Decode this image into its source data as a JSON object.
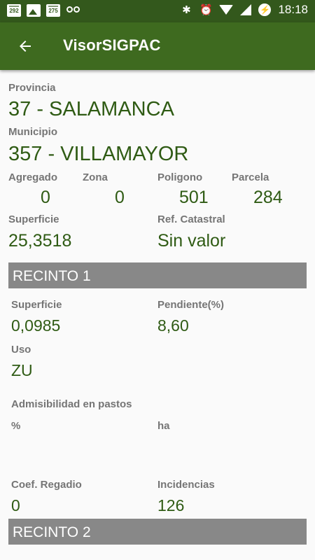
{
  "status_bar": {
    "notif_1": "292",
    "notif_2": "275",
    "time": "18:18"
  },
  "app_bar": {
    "title": "VisorSIGPAC"
  },
  "parcel": {
    "provincia_label": "Provincia",
    "provincia_value": "37 - SALAMANCA",
    "municipio_label": "Municipio",
    "municipio_value": "357 - VILLAMAYOR",
    "agregado_label": "Agregado",
    "agregado_value": "0",
    "zona_label": "Zona",
    "zona_value": "0",
    "poligono_label": "Poligono",
    "poligono_value": "501",
    "parcela_label": "Parcela",
    "parcela_value": "284",
    "superficie_label": "Superficie",
    "superficie_value": "25,3518",
    "ref_catastral_label": "Ref. Catastral",
    "ref_catastral_value": "Sin valor"
  },
  "recinto_1": {
    "header": "RECINTO 1",
    "superficie_label": "Superficie",
    "superficie_value": "0,0985",
    "pendiente_label": "Pendiente(%)",
    "pendiente_value": "8,60",
    "uso_label": "Uso",
    "uso_value": "ZU",
    "admisibilidad_label": "Admisibilidad en pastos",
    "porcentaje_label": "%",
    "ha_label": "ha",
    "coef_regadio_label": "Coef. Regadio",
    "coef_regadio_value": "0",
    "incidencias_label": "Incidencias",
    "incidencias_value": "126"
  },
  "recinto_2": {
    "header": "RECINTO 2"
  },
  "colors": {
    "status_bar": "#33581c",
    "app_bar": "#3e6a1f",
    "value_text": "#2f5b14",
    "label_text": "#757575",
    "section_header": "#888888"
  }
}
